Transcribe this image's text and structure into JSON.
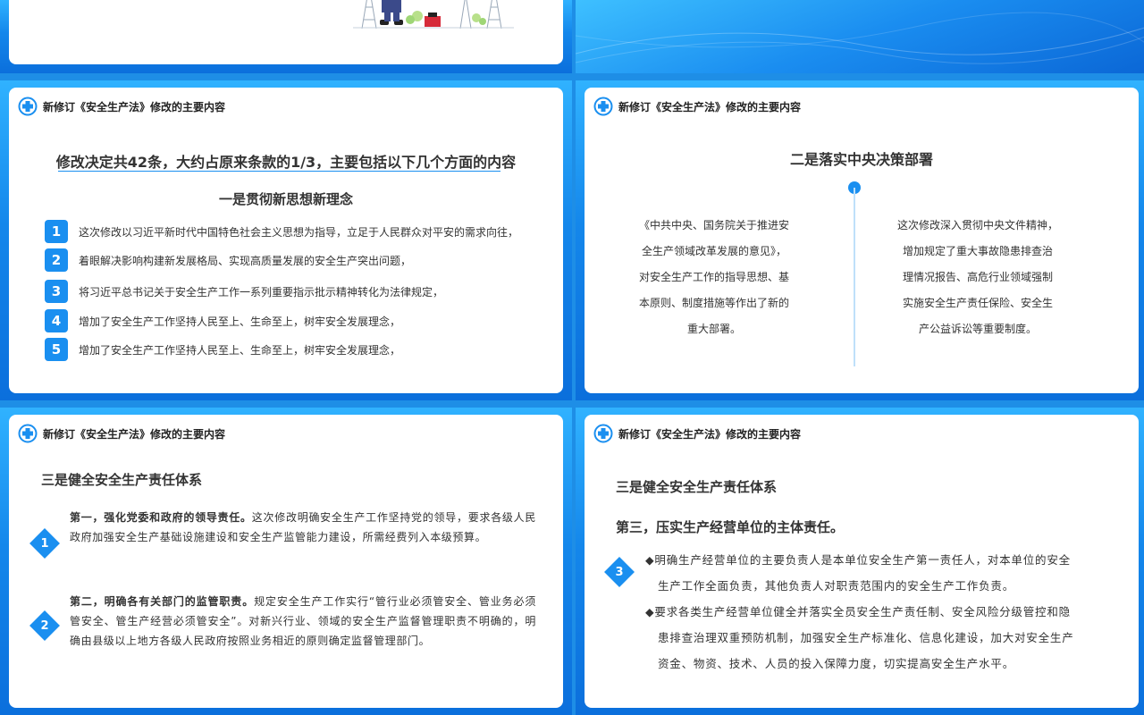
{
  "header_title": "新修订《安全生产法》修改的主要内容",
  "colors": {
    "accent": "#1a8ff0",
    "background": "#1e8ee6",
    "card": "#ffffff"
  },
  "slide3": {
    "title": "修改决定共42条，大约占原来条款的1/3，主要包括以下几个方面的内容",
    "subtitle": "一是贯彻新思想新理念",
    "items": [
      {
        "num": "1",
        "text": "这次修改以习近平新时代中国特色社会主义思想为指导，立足于人民群众对平安的需求向往，"
      },
      {
        "num": "2",
        "text": "着眼解决影响构建新发展格局、实现高质量发展的安全生产突出问题，"
      },
      {
        "num": "3",
        "text": "将习近平总书记关于安全生产工作一系列重要指示批示精神转化为法律规定，"
      },
      {
        "num": "4",
        "text": "增加了安全生产工作坚持人民至上、生命至上，树牢安全发展理念，"
      },
      {
        "num": "5",
        "text": "增加了安全生产工作坚持人民至上、生命至上，树牢安全发展理念，"
      }
    ]
  },
  "slide4": {
    "title": "二是落实中央决策部署",
    "left_lines": [
      "《中共中央、国务院关于推进安",
      "全生产领域改革发展的意见》，",
      "对安全生产工作的指导思想、基",
      "本原则、制度措施等作出了新的",
      "重大部署。"
    ],
    "right_lines": [
      "这次修改深入贯彻中央文件精神，",
      "增加规定了重大事故隐患排查治",
      "理情况报告、高危行业领域强制",
      "实施安全生产责任保险、安全生",
      "产公益诉讼等重要制度。"
    ]
  },
  "slide5": {
    "title": "三是健全安全生产责任体系",
    "points": [
      {
        "num": "1",
        "bold": "第一，强化党委和政府的领导责任。",
        "text": "这次修改明确安全生产工作坚持党的领导，要求各级人民政府加强安全生产基础设施建设和安全生产监管能力建设，所需经费列入本级预算。"
      },
      {
        "num": "2",
        "bold": "第二，明确各有关部门的监管职责。",
        "text": "规定安全生产工作实行“管行业必须管安全、管业务必须管安全、管生产经营必须管安全”。对新兴行业、领域的安全生产监督管理职责不明确的，明确由县级以上地方各级人民政府按照业务相近的原则确定监督管理部门。"
      }
    ]
  },
  "slide6": {
    "title": "三是健全安全生产责任体系",
    "subtitle": "第三，压实生产经营单位的主体责任。",
    "num": "3",
    "bullets": [
      [
        "◆明确生产经营单位的主要负责人是本单位安全生产第一责任人，对本单位的安全",
        "生产工作全面负责，其他负责人对职责范围内的安全生产工作负责。"
      ],
      [
        "◆要求各类生产经营单位健全并落实全员安全生产责任制、安全风险分级管控和隐",
        "患排查治理双重预防机制，加强安全生产标准化、信息化建设，加大对安全生产",
        "资金、物资、技术、人员的投入保障力度，切实提高安全生产水平。"
      ]
    ]
  }
}
